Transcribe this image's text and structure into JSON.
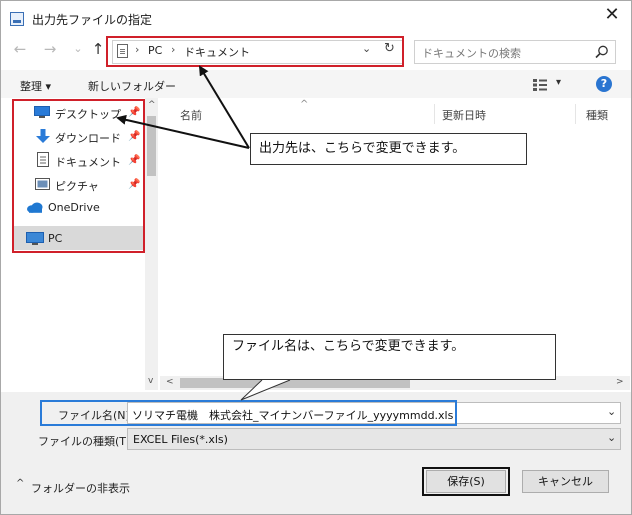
{
  "window": {
    "title": "出力先ファイルの指定",
    "close_glyph": "✕"
  },
  "address_bar": {
    "path": [
      "PC",
      "ドキュメント"
    ],
    "separator": "›",
    "dropdown_glyph": "⌄",
    "refresh_glyph": "↻"
  },
  "search": {
    "placeholder": "ドキュメントの検索"
  },
  "nav_buttons": {
    "back": "←",
    "forward": "→",
    "history": "⌄",
    "up": "↑"
  },
  "toolbar": {
    "organize_label": "整理 ▾",
    "new_folder_label": "新しいフォルダー",
    "view_chevron": "▾",
    "help_label": "?"
  },
  "sidebar": {
    "items": [
      {
        "label": "デスクトップ",
        "pinned": true
      },
      {
        "label": "ダウンロード",
        "pinned": true
      },
      {
        "label": "ドキュメント",
        "pinned": true
      },
      {
        "label": "ピクチャ",
        "pinned": true
      },
      {
        "label": "OneDrive",
        "pinned": false
      },
      {
        "label": "PC",
        "pinned": false
      }
    ],
    "pin_glyph": "📌"
  },
  "columns": {
    "name": "名前",
    "modified": "更新日時",
    "type": "種類"
  },
  "scroll": {
    "up": "^",
    "down": "v",
    "left": "<",
    "right": ">",
    "sort": "^"
  },
  "fields": {
    "filename_label": "ファイル名(N):",
    "filename_value": "ソリマチ電機　株式会社_マイナンバーファイル_yyyymmdd.xls",
    "filetype_label": "ファイルの種類(T):",
    "filetype_value": "EXCEL Files(*.xls)",
    "dropdown_glyph": "⌄"
  },
  "footer": {
    "hide_folders_label": "フォルダーの非表示",
    "hide_folders_glyph": "^",
    "save_label": "保存(S)",
    "cancel_label": "キャンセル"
  },
  "callouts": {
    "destination": "出力先は、こちらで変更できます。",
    "filename": "ファイル名は、こちらで変更できます。"
  },
  "colors": {
    "highlight_red": "#d0202a",
    "highlight_blue": "#2a7bd8",
    "accent": "#2a75d1"
  }
}
